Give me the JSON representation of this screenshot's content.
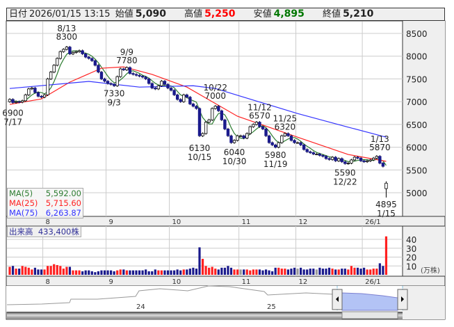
{
  "header": {
    "date_label": "日付",
    "datetime": "2026/01/15 13:15",
    "open_label": "始値",
    "open": "5,090",
    "high_label": "高値",
    "high": "5,250",
    "low_label": "安値",
    "low": "4,895",
    "close_label": "終値",
    "close": "5,210"
  },
  "legend": {
    "ma5": {
      "label": "MA(5)",
      "value": "5,592.00",
      "color": "#2e7d32"
    },
    "ma25": {
      "label": "MA(25)",
      "value": "5,715.60",
      "color": "#ff2222"
    },
    "ma75": {
      "label": "MA(75)",
      "value": "6,263.87",
      "color": "#3333ff"
    }
  },
  "volume_legend": {
    "label": "出来高",
    "value": "433,400株"
  },
  "volume_unit": "(万株)",
  "navigator": {
    "labels": [
      "24",
      "25"
    ]
  },
  "chart_data": {
    "type": "candlestick",
    "price_axis": {
      "ticks": [
        8500,
        8000,
        7500,
        7000,
        6500,
        6000,
        5500,
        5000
      ],
      "ylim": [
        4700,
        8650
      ]
    },
    "volume_axis": {
      "ticks": [
        40,
        30,
        20,
        10
      ],
      "unit": "万株",
      "ylim": [
        0,
        45
      ]
    },
    "months": [
      {
        "label": "8",
        "start_idx": 11
      },
      {
        "label": "9",
        "start_idx": 31
      },
      {
        "label": "10",
        "start_idx": 51
      },
      {
        "label": "11",
        "start_idx": 73
      },
      {
        "label": "12",
        "start_idx": 91
      },
      {
        "label": "26/1",
        "start_idx": 112
      }
    ],
    "open": [
      7000,
      7050,
      6980,
      7000,
      6990,
      7020,
      7150,
      7280,
      7300,
      7200,
      7120,
      7100,
      7150,
      7500,
      7650,
      7800,
      7950,
      8100,
      8150,
      8200,
      8050,
      8080,
      8100,
      8120,
      8050,
      7980,
      7950,
      7900,
      7800,
      7650,
      7500,
      7450,
      7400,
      7380,
      7350,
      7550,
      7720,
      7700,
      7750,
      7620,
      7600,
      7580,
      7560,
      7540,
      7500,
      7400,
      7300,
      7280,
      7350,
      7450,
      7380,
      7300,
      7250,
      7150,
      7050,
      7000,
      7150,
      7100,
      6950,
      6900,
      6850,
      6250,
      6300,
      6550,
      6600,
      6850,
      6900,
      6800,
      6600,
      6400,
      6250,
      6100,
      6150,
      6250,
      6250,
      6200,
      6300,
      6450,
      6500,
      6550,
      6450,
      6400,
      6250,
      6100,
      6050,
      6000,
      6100,
      6250,
      6300,
      6250,
      6150,
      6100,
      6100,
      6050,
      5950,
      5900,
      5880,
      5850,
      5850,
      5820,
      5800,
      5750,
      5730,
      5780,
      5700,
      5750,
      5680,
      5640,
      5650,
      5720,
      5780,
      5760,
      5700,
      5680,
      5700,
      5720,
      5760,
      5800,
      5650,
      5090
    ],
    "close": [
      7050,
      6980,
      7000,
      6990,
      7020,
      7150,
      7280,
      7300,
      7200,
      7120,
      7100,
      7150,
      7500,
      7650,
      7800,
      7950,
      8100,
      8150,
      8200,
      8050,
      8080,
      8100,
      8120,
      8050,
      7980,
      7950,
      7900,
      7800,
      7650,
      7500,
      7450,
      7400,
      7380,
      7350,
      7550,
      7720,
      7700,
      7750,
      7620,
      7600,
      7580,
      7560,
      7540,
      7500,
      7400,
      7300,
      7280,
      7350,
      7450,
      7380,
      7300,
      7250,
      7150,
      7050,
      7000,
      7150,
      7100,
      6950,
      6900,
      6850,
      6250,
      6300,
      6550,
      6600,
      6850,
      6900,
      6800,
      6600,
      6400,
      6250,
      6100,
      6150,
      6250,
      6250,
      6200,
      6300,
      6450,
      6500,
      6550,
      6450,
      6400,
      6250,
      6100,
      6050,
      6000,
      6100,
      6250,
      6300,
      6250,
      6150,
      6100,
      6100,
      6050,
      5950,
      5900,
      5880,
      5850,
      5850,
      5820,
      5800,
      5750,
      5730,
      5780,
      5700,
      5750,
      5680,
      5640,
      5650,
      5720,
      5780,
      5760,
      5700,
      5680,
      5700,
      5720,
      5760,
      5800,
      5650,
      5580,
      5210
    ],
    "volume": [
      9,
      10,
      7,
      7,
      10,
      9,
      8,
      6,
      8,
      6,
      6,
      6,
      10,
      10,
      12,
      11,
      10,
      7,
      9,
      9,
      5,
      5,
      5,
      4,
      5,
      5,
      4,
      3,
      4,
      5,
      5,
      5,
      5,
      4,
      5,
      6,
      6,
      5,
      5,
      5,
      5,
      5,
      5,
      6,
      4,
      4,
      6,
      5,
      5,
      5,
      5,
      5,
      5,
      6,
      5,
      6,
      6,
      7,
      8,
      7,
      31,
      18,
      10,
      8,
      9,
      7,
      6,
      8,
      8,
      10,
      8,
      6,
      6,
      6,
      6,
      6,
      5,
      6,
      6,
      6,
      5,
      6,
      5,
      4,
      8,
      8,
      7,
      7,
      6,
      7,
      8,
      7,
      8,
      6,
      6,
      7,
      7,
      6,
      8,
      7,
      7,
      8,
      7,
      6,
      6,
      7,
      7,
      6,
      10,
      8,
      8,
      7,
      8,
      6,
      6,
      7,
      7,
      13,
      10,
      43.34
    ],
    "ma25_points": [
      [
        0,
        6940
      ],
      [
        10,
        7060
      ],
      [
        19,
        7430
      ],
      [
        29,
        7735
      ],
      [
        36,
        7765
      ],
      [
        45,
        7600
      ],
      [
        56,
        7320
      ],
      [
        72,
        6680
      ],
      [
        91,
        6220
      ],
      [
        107,
        5840
      ],
      [
        119,
        5690
      ]
    ],
    "ma75_points": [
      [
        0,
        7290
      ],
      [
        25,
        7445
      ],
      [
        41,
        7320
      ],
      [
        58,
        7350
      ],
      [
        65,
        7290
      ],
      [
        72,
        7140
      ],
      [
        91,
        6740
      ],
      [
        107,
        6440
      ],
      [
        119,
        6220
      ]
    ],
    "annotations": [
      {
        "date": "7/17",
        "value": "6900",
        "idx": 1,
        "pos": "below"
      },
      {
        "date": "8/13",
        "value": "8300",
        "idx": 18,
        "pos": "above"
      },
      {
        "date": "9/3",
        "value": "7330",
        "idx": 33,
        "pos": "below"
      },
      {
        "date": "9/9",
        "value": "7780",
        "idx": 37,
        "pos": "above"
      },
      {
        "date": "10/15",
        "value": "6130",
        "idx": 60,
        "pos": "below"
      },
      {
        "date": "10/22",
        "value": "7000",
        "idx": 65,
        "pos": "above"
      },
      {
        "date": "10/30",
        "value": "6040",
        "idx": 71,
        "pos": "below"
      },
      {
        "date": "11/12",
        "value": "6570",
        "idx": 79,
        "pos": "above"
      },
      {
        "date": "11/19",
        "value": "5980",
        "idx": 84,
        "pos": "below"
      },
      {
        "date": "11/25",
        "value": "6320",
        "idx": 87,
        "pos": "above"
      },
      {
        "date": "12/22",
        "value": "5590",
        "idx": 106,
        "pos": "below"
      },
      {
        "date": "1/13",
        "value": "5870",
        "idx": 117,
        "pos": "above"
      },
      {
        "date": "1/15",
        "value": "4895",
        "idx": 119,
        "pos": "below"
      }
    ],
    "colors": {
      "up_fill": "#ffffff",
      "down_fill": "#1a1a8c",
      "vol_up": "#ff2020",
      "vol_down": "#1a1a8c",
      "vol_flat": "#999999"
    }
  }
}
